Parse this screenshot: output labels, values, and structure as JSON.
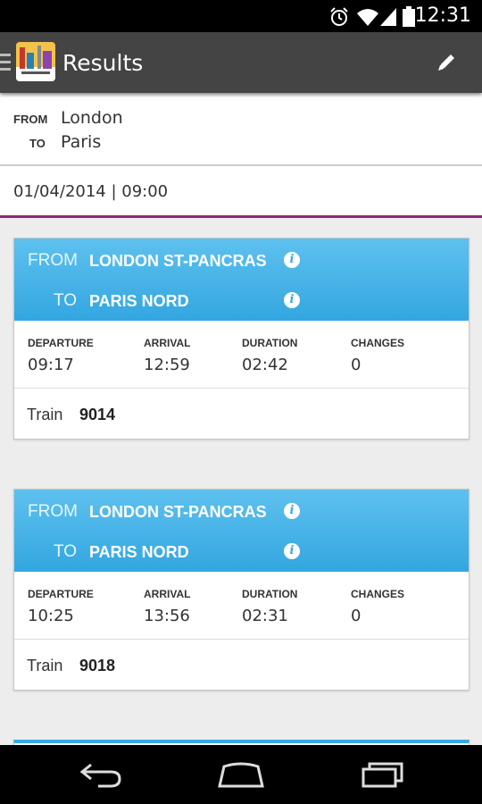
{
  "status_bar": {
    "time": "12:31",
    "icons": [
      "alarm-icon",
      "wifi-icon",
      "signal-icon",
      "battery-icon"
    ]
  },
  "action_bar": {
    "title": "Results",
    "icons": [
      "menu-icon",
      "app-logo-icon",
      "edit-icon"
    ]
  },
  "search": {
    "from_label": "FROM",
    "from_value": "London",
    "to_label": "TO",
    "to_value": "Paris",
    "datetime": "01/04/2014  |  09:00"
  },
  "labels": {
    "from": "FROM",
    "to": "TO",
    "departure": "DEPARTURE",
    "arrival": "ARRIVAL",
    "duration": "DURATION",
    "changes": "CHANGES",
    "train": "Train"
  },
  "results": [
    {
      "from_station": "LONDON ST-PANCRAS",
      "to_station": "PARIS NORD",
      "departure": "09:17",
      "arrival": "12:59",
      "duration": "02:42",
      "changes": "0",
      "train_number": "9014"
    },
    {
      "from_station": "LONDON ST-PANCRAS",
      "to_station": "PARIS NORD",
      "departure": "10:25",
      "arrival": "13:56",
      "duration": "02:31",
      "changes": "0",
      "train_number": "9018"
    }
  ],
  "nav_bar": {
    "icons": [
      "back-icon",
      "home-icon",
      "recent-apps-icon"
    ]
  },
  "colors": {
    "accent_bar": "#8e2a74",
    "card_header": "#3aa9e2",
    "action_bar": "#444444"
  }
}
